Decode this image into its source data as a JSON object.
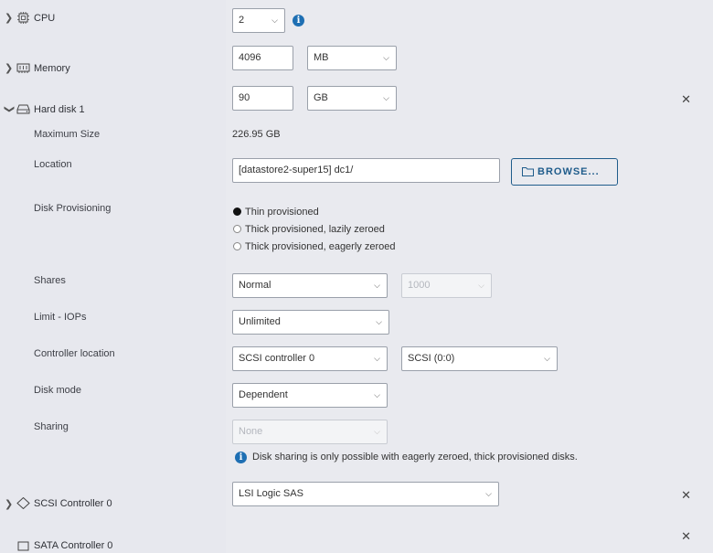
{
  "cpu": {
    "label": "CPU",
    "value": "2"
  },
  "memory": {
    "label": "Memory",
    "value": "4096",
    "unit": "MB"
  },
  "hard_disk": {
    "label": "Hard disk 1",
    "size_value": "90",
    "size_unit": "GB",
    "maximum_size_label": "Maximum Size",
    "maximum_size_value": "226.95 GB",
    "location_label": "Location",
    "location_value": "[datastore2-super15] dc1/",
    "browse_label": "BROWSE...",
    "provisioning_label": "Disk Provisioning",
    "provisioning_options": [
      "Thin provisioned",
      "Thick provisioned, lazily zeroed",
      "Thick provisioned, eagerly zeroed"
    ],
    "shares_label": "Shares",
    "shares_value": "Normal",
    "shares_number": "1000",
    "limit_label": "Limit - IOPs",
    "limit_value": "Unlimited",
    "controller_label": "Controller location",
    "controller_value": "SCSI controller 0",
    "controller_slot": "SCSI (0:0)",
    "disk_mode_label": "Disk mode",
    "disk_mode_value": "Dependent",
    "sharing_label": "Sharing",
    "sharing_value": "None",
    "sharing_note": "Disk sharing is only possible with eagerly zeroed, thick provisioned disks."
  },
  "scsi_controller": {
    "label": "SCSI Controller 0",
    "value": "LSI Logic SAS"
  },
  "sata_controller": {
    "label": "SATA Controller 0"
  },
  "icons": {
    "expand": "chevron-right-icon",
    "collapse": "chevron-down-icon",
    "info": "info-icon",
    "close": "close-icon",
    "folder": "folder-icon"
  }
}
